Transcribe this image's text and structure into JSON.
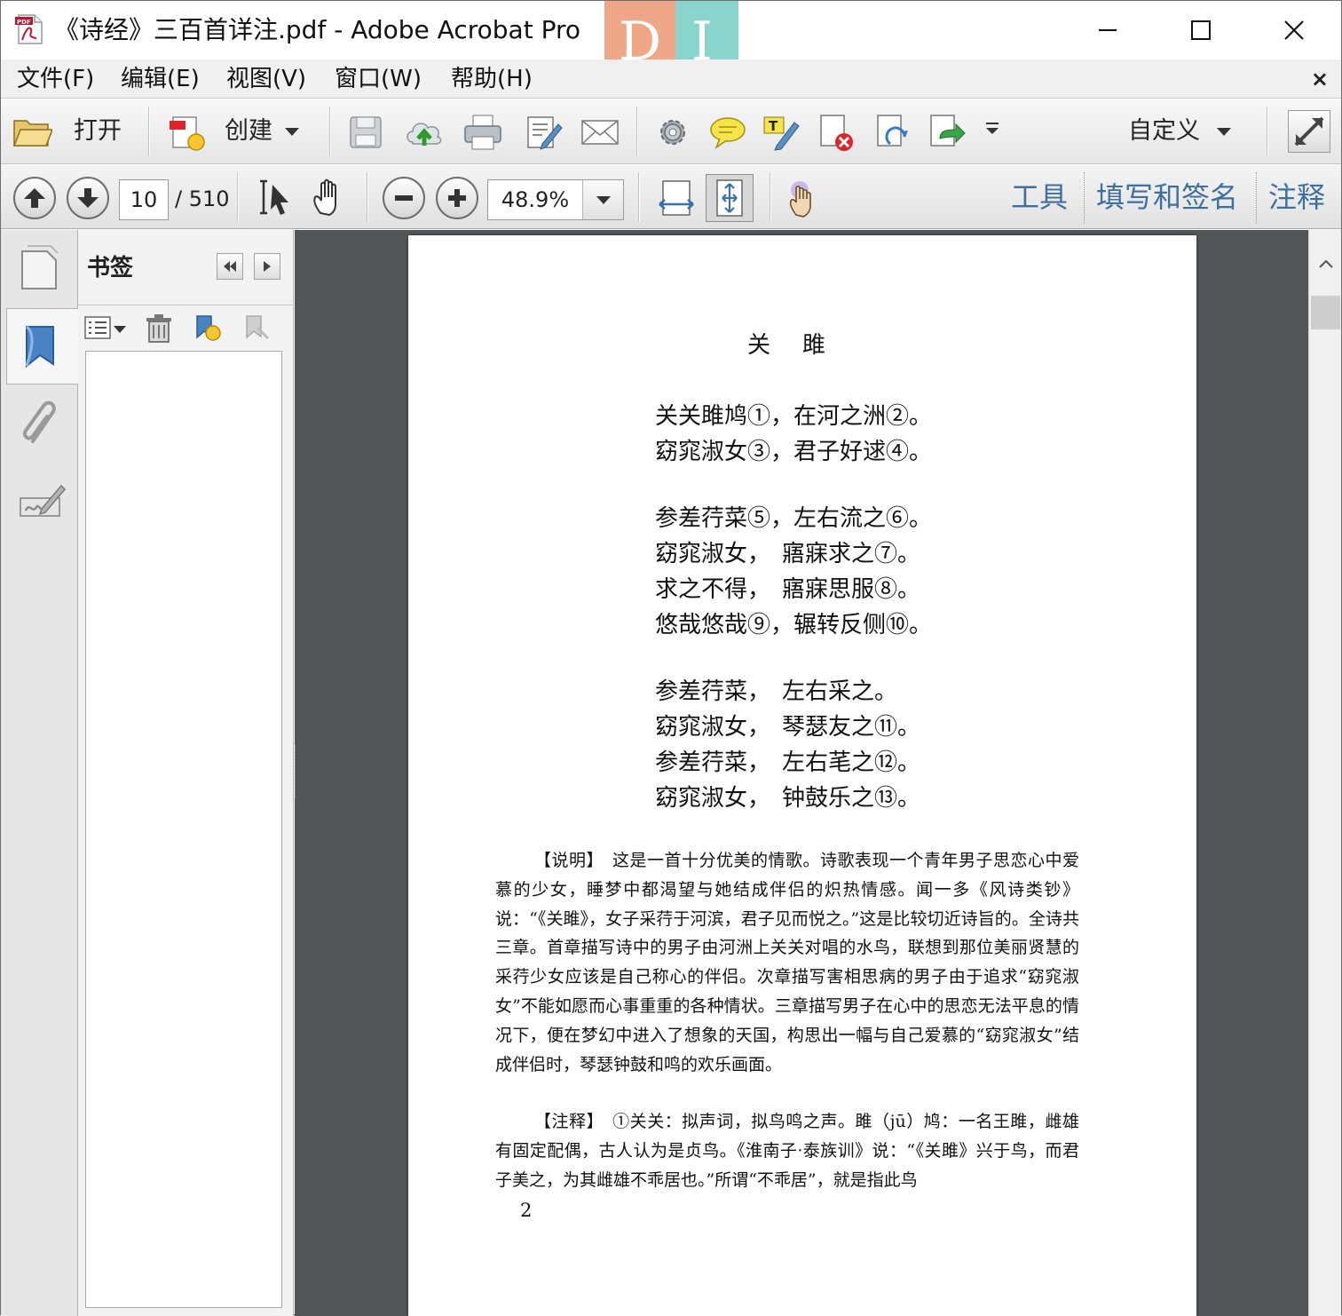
{
  "window": {
    "title": "《诗经》三百首详注.pdf - Adobe Acrobat Pro",
    "watermark_left": "D",
    "watermark_right": "I"
  },
  "menu": [
    "文件(F)",
    "编辑(E)",
    "视图(V)",
    "窗口(W)",
    "帮助(H)"
  ],
  "menu_close": "×",
  "toolbar": {
    "open_label": "打开",
    "create_label": "创建",
    "customize_label": "自定义"
  },
  "navigation": {
    "current_page": "10",
    "total_pages": "/ 510",
    "zoom": "48.9%"
  },
  "task_panes": [
    "工具",
    "填写和签名",
    "注释"
  ],
  "bookmarks_panel": {
    "title": "书签"
  },
  "document": {
    "title": "关雎",
    "stanzas": [
      [
        "关关雎鸠①，在河之洲②。",
        "窈窕淑女③，君子好逑④。"
      ],
      [
        "参差荇菜⑤，左右流之⑥。",
        "窈窕淑女，　寤寐求之⑦。",
        "求之不得，　寤寐思服⑧。",
        "悠哉悠哉⑨，辗转反侧⑩。"
      ],
      [
        "参差荇菜，　左右采之。",
        "窈窕淑女，　琴瑟友之⑪。",
        "参差荇菜，　左右芼之⑫。",
        "窈窕淑女，　钟鼓乐之⑬。"
      ]
    ],
    "explanation": "【说明】　这是一首十分优美的情歌。诗歌表现一个青年男子思恋心中爱慕的少女，睡梦中都渴望与她结成伴侣的炽热情感。闻一多《风诗类钞》说：“《关雎》，女子采荇于河滨，君子见而悦之。”这是比较切近诗旨的。全诗共三章。首章描写诗中的男子由河洲上关关对唱的水鸟，联想到那位美丽贤慧的采荇少女应该是自己称心的伴侣。次章描写害相思病的男子由于追求“窈窕淑女”不能如愿而心事重重的各种情状。三章描写男子在心中的思恋无法平息的情况下，便在梦幻中进入了想象的天国，构思出一幅与自己爱慕的“窈窕淑女”结成伴侣时，琴瑟钟鼓和鸣的欢乐画面。",
    "notes": "【注释】　①关关：拟声词，拟鸟鸣之声。雎（jū）鸠：一名王雎，雌雄有固定配偶，古人认为是贞鸟。《淮南子·泰族训》说：“《关雎》兴于鸟，而君子美之，为其雌雄不乖居也。”所谓“不乖居”，就是指此鸟",
    "page_number": "2"
  }
}
